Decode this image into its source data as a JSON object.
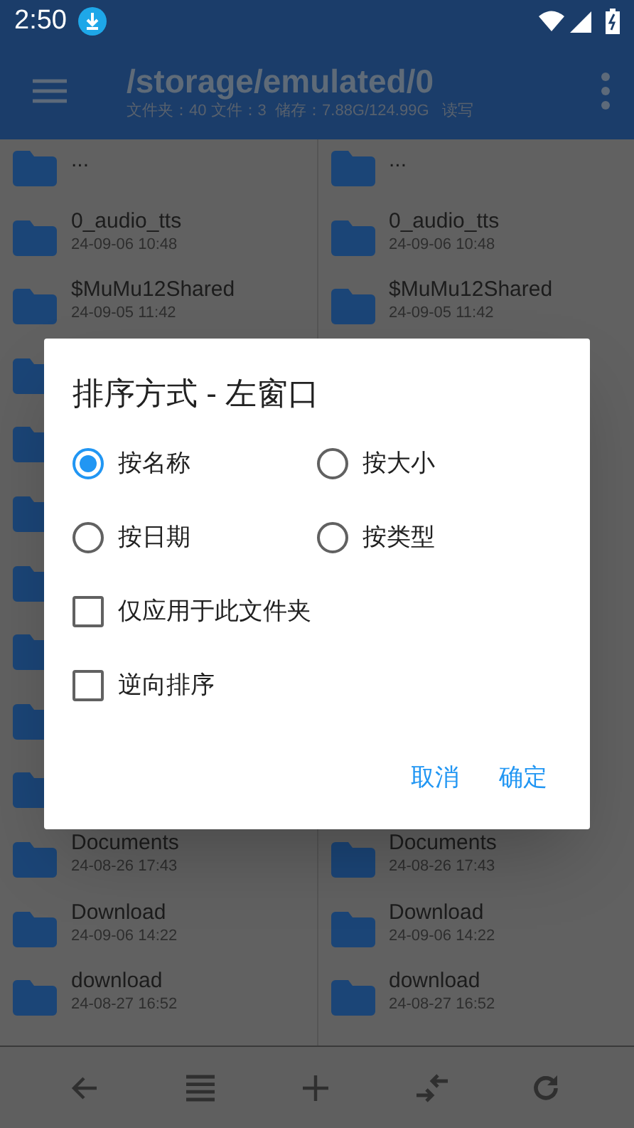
{
  "status_bar": {
    "time": "2:50"
  },
  "app_bar": {
    "title": "/storage/emulated/0",
    "subtitle": "文件夹：40 文件：3  储存：7.88G/124.99G   读写"
  },
  "panes": [
    {
      "items": [
        {
          "kind": "parent",
          "name": "..."
        },
        {
          "kind": "folder",
          "name": "0_audio_tts",
          "date": "24-09-06 10:48"
        },
        {
          "kind": "folder",
          "name": "$MuMu12Shared",
          "date": "24-09-05 11:42"
        },
        {
          "kind": "covered"
        },
        {
          "kind": "covered"
        },
        {
          "kind": "covered"
        },
        {
          "kind": "covered"
        },
        {
          "kind": "covered"
        },
        {
          "kind": "covered"
        },
        {
          "kind": "covered"
        },
        {
          "kind": "folder",
          "name": "Documents",
          "date": "24-08-26 17:43"
        },
        {
          "kind": "folder",
          "name": "Download",
          "date": "24-09-06 14:22"
        },
        {
          "kind": "folder",
          "name": "download",
          "date": "24-08-27 16:52"
        }
      ]
    },
    {
      "items": [
        {
          "kind": "parent",
          "name": "..."
        },
        {
          "kind": "folder",
          "name": "0_audio_tts",
          "date": "24-09-06 10:48"
        },
        {
          "kind": "folder",
          "name": "$MuMu12Shared",
          "date": "24-09-05 11:42"
        },
        {
          "kind": "hidden"
        },
        {
          "kind": "hidden"
        },
        {
          "kind": "hidden"
        },
        {
          "kind": "hidden"
        },
        {
          "kind": "hidden"
        },
        {
          "kind": "hidden"
        },
        {
          "kind": "hidden"
        },
        {
          "kind": "folder",
          "name": "Documents",
          "date": "24-08-26 17:43"
        },
        {
          "kind": "folder",
          "name": "Download",
          "date": "24-09-06 14:22"
        },
        {
          "kind": "folder",
          "name": "download",
          "date": "24-08-27 16:52"
        }
      ]
    }
  ],
  "dialog": {
    "title": "排序方式 - 左窗口",
    "options": [
      {
        "label": "按名称",
        "selected": true
      },
      {
        "label": "按大小",
        "selected": false
      },
      {
        "label": "按日期",
        "selected": false
      },
      {
        "label": "按类型",
        "selected": false
      }
    ],
    "checkboxes": [
      {
        "label": "仅应用于此文件夹",
        "checked": false
      },
      {
        "label": "逆向排序",
        "checked": false
      }
    ],
    "buttons": [
      "取消",
      "确定"
    ]
  },
  "toolbar": [
    {
      "kind": "back"
    },
    {
      "kind": "list"
    },
    {
      "kind": "add"
    },
    {
      "kind": "swap"
    },
    {
      "kind": "refresh"
    }
  ]
}
